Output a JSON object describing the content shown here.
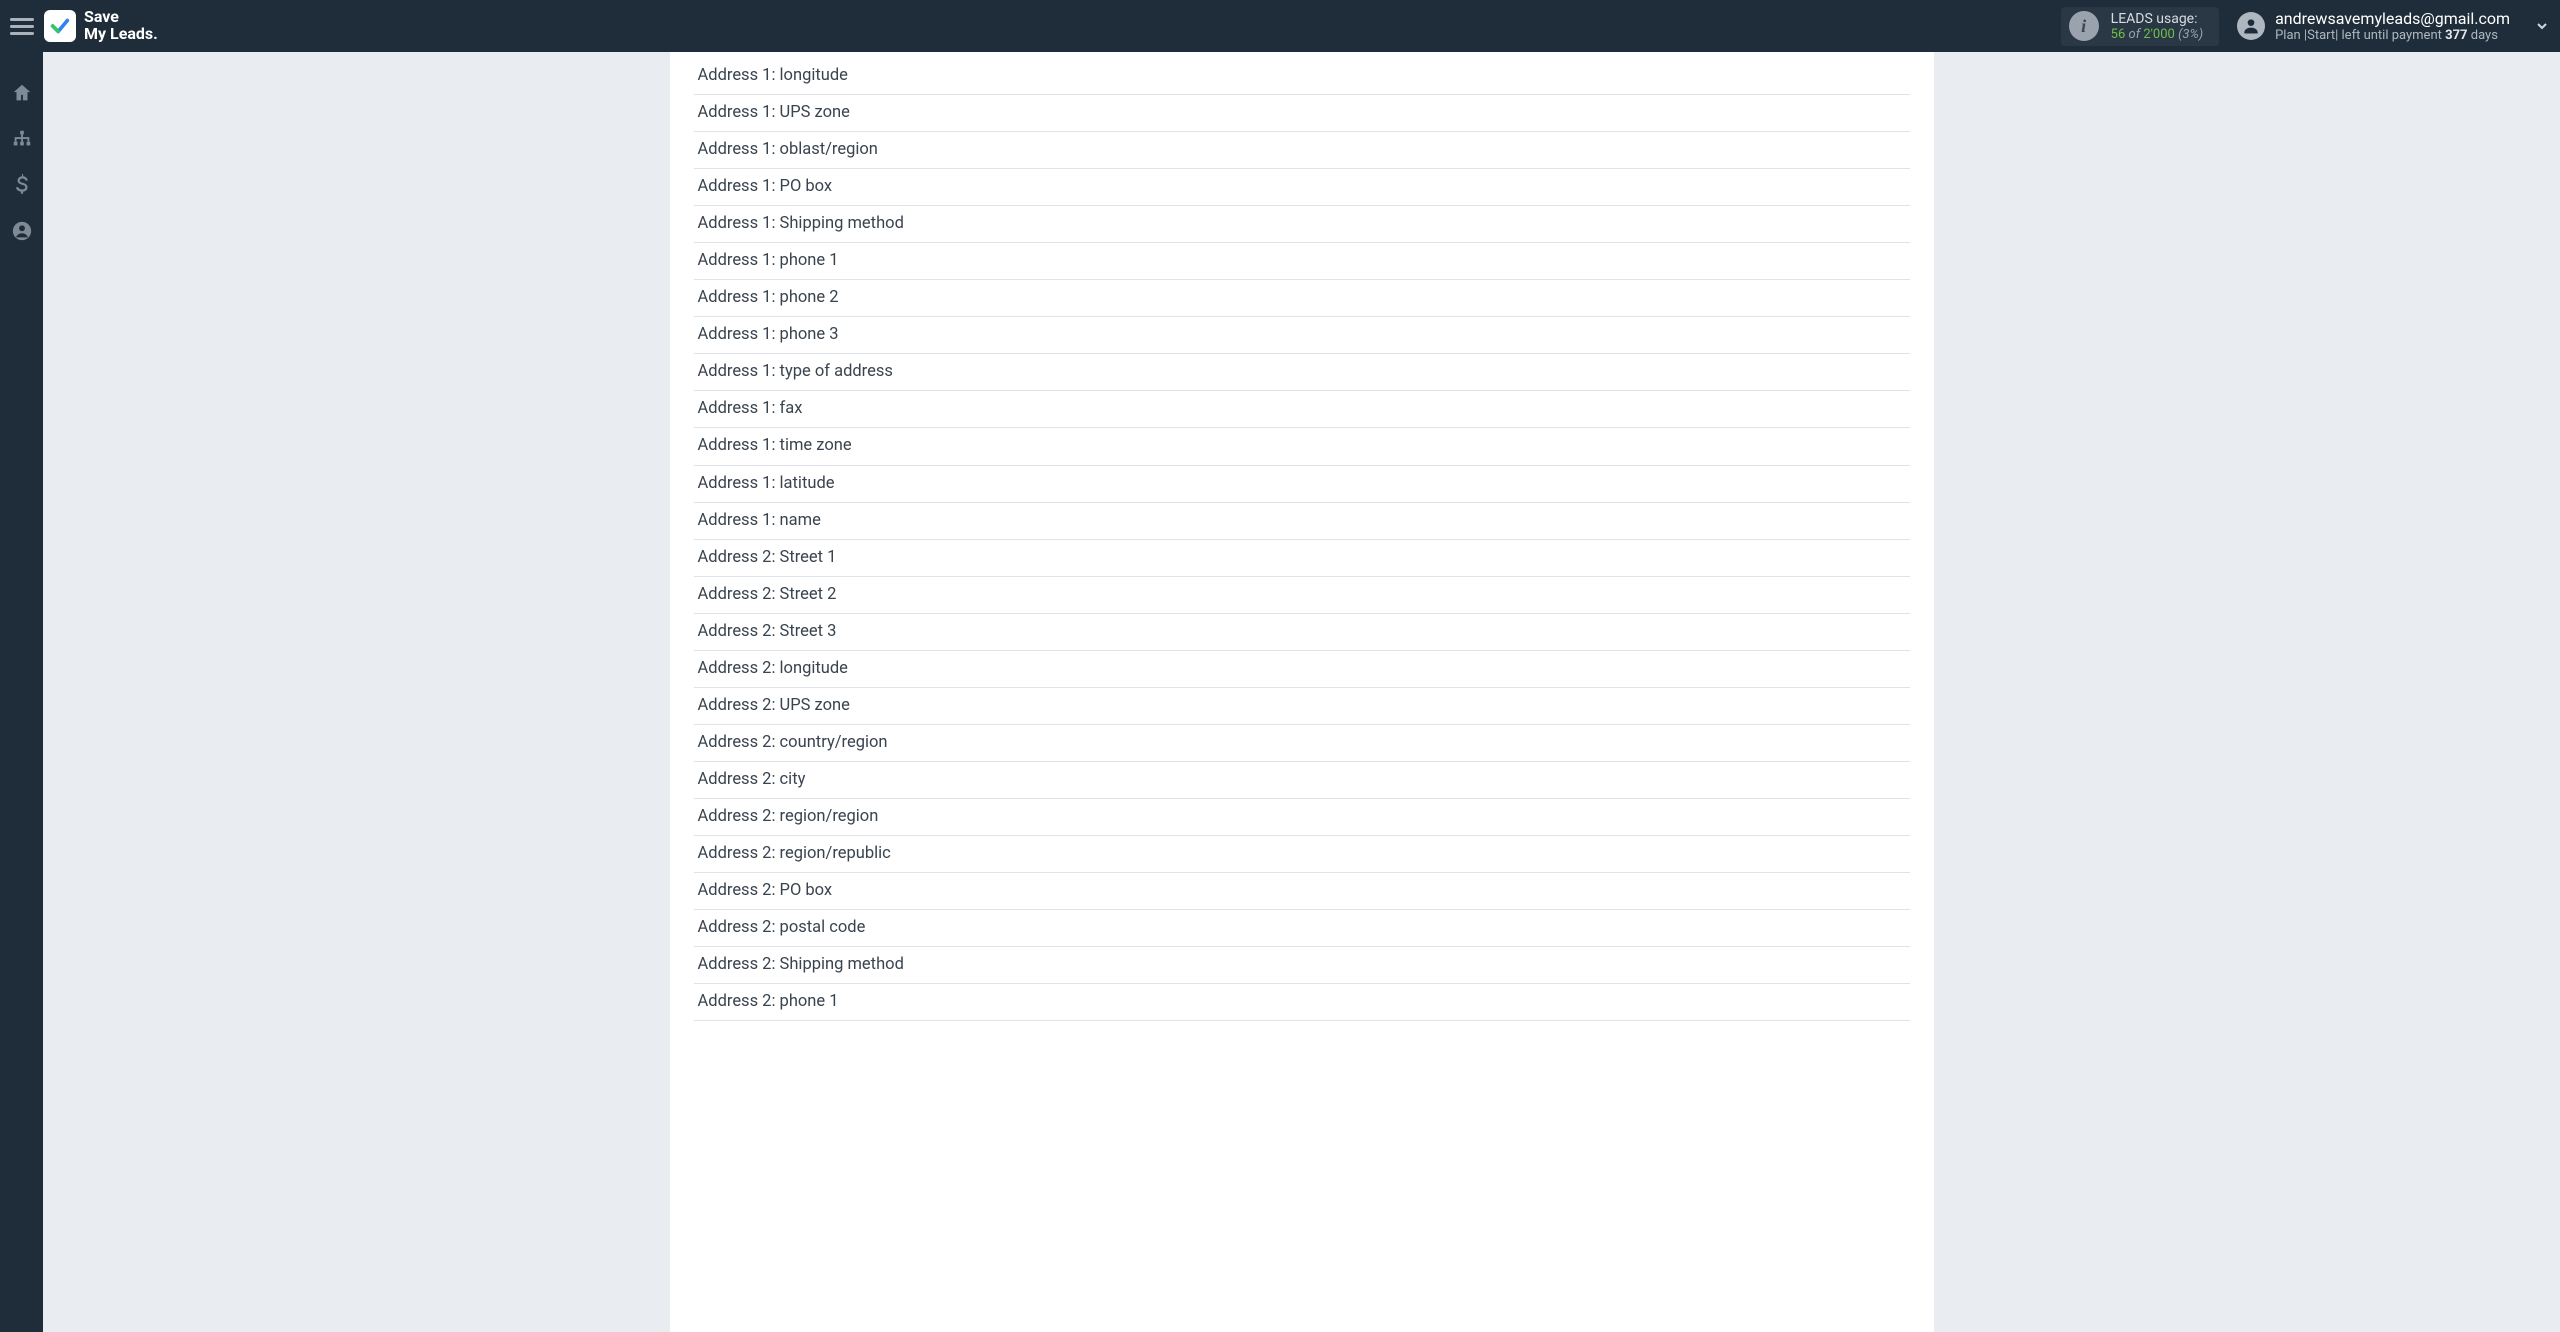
{
  "brand": {
    "line1": "Save",
    "line2": "My Leads."
  },
  "usage": {
    "label": "LEADS usage:",
    "used": "56",
    "of_word": "of",
    "total": "2'000",
    "percent": "(3%)"
  },
  "user": {
    "email": "andrewsavemyleads@gmail.com",
    "plan_prefix": "Plan |Start| left until payment",
    "days_number": "377",
    "days_word": "days"
  },
  "fields": [
    "Address 1: longitude",
    "Address 1: UPS zone",
    "Address 1: oblast/region",
    "Address 1: PO box",
    "Address 1: Shipping method",
    "Address 1: phone 1",
    "Address 1: phone 2",
    "Address 1: phone 3",
    "Address 1: type of address",
    "Address 1: fax",
    "Address 1: time zone",
    "Address 1: latitude",
    "Address 1: name",
    "Address 2: Street 1",
    "Address 2: Street 2",
    "Address 2: Street 3",
    "Address 2: longitude",
    "Address 2: UPS zone",
    "Address 2: country/region",
    "Address 2: city",
    "Address 2: region/region",
    "Address 2: region/republic",
    "Address 2: PO box",
    "Address 2: postal code",
    "Address 2: Shipping method",
    "Address 2: phone 1"
  ]
}
